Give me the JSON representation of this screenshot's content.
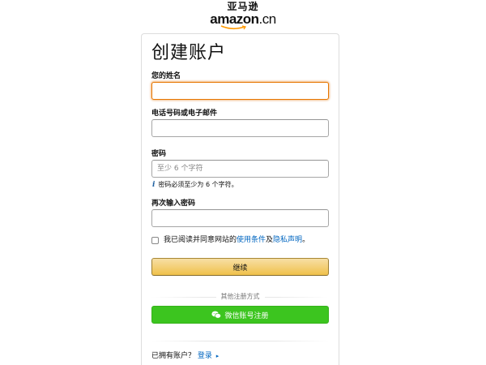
{
  "logo": {
    "cn": "亚马逊",
    "en": "amazon",
    "suffix": ".cn"
  },
  "form": {
    "title": "创建账户",
    "name_label": "您的姓名",
    "name_value": "",
    "contact_label": "电话号码或电子邮件",
    "contact_value": "",
    "password_label": "密码",
    "password_placeholder": "至少 6 个字符",
    "password_hint": "密码必须至少为 6 个字符。",
    "confirm_label": "再次输入密码",
    "confirm_value": "",
    "agree_prefix": "我已阅读并同意网站的",
    "terms_link": "使用条件",
    "agree_and": "及",
    "privacy_link": "隐私声明",
    "agree_suffix": "。",
    "continue_label": "继续",
    "other_methods": "其他注册方式",
    "wechat_label": "微信账号注册",
    "have_account": "已拥有账户？",
    "signin_link": "登录"
  },
  "icons": {
    "hint": "info-icon",
    "wechat": "wechat-icon",
    "caret": "caret-right-icon"
  },
  "colors": {
    "continue_button": "#f0c14b",
    "wechat_button": "#3cc51f",
    "link": "#0066c0",
    "focus_border": "#e77600"
  }
}
